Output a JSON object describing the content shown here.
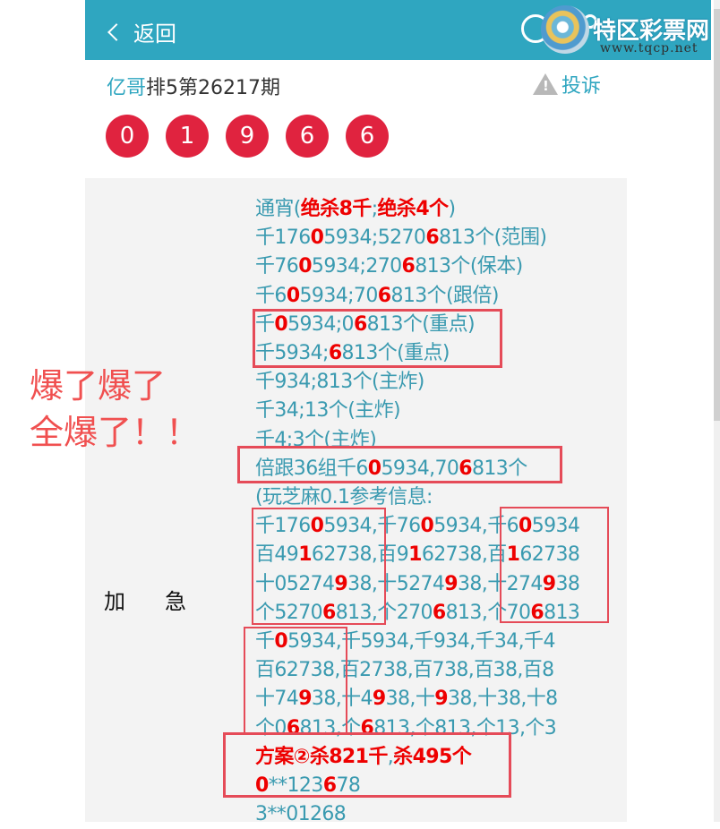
{
  "header": {
    "back_label": "返回",
    "logo_title": "特区彩票网",
    "logo_url": "www.tqcp.net",
    "colors": {
      "bar": "#2fa6c0",
      "ball": "#e0233f",
      "highlight": "#ee0000",
      "annotation": "#f05050"
    }
  },
  "post": {
    "author": "亿哥",
    "title_rest": "排5第26217期",
    "report_label": "投诉",
    "balls": [
      "0",
      "1",
      "9",
      "6",
      "6"
    ],
    "label": "加急"
  },
  "annotation": {
    "line1": "爆了爆了",
    "line2": "全爆了！！"
  },
  "content": {
    "lines": [
      [
        {
          "t": "通宵("
        },
        {
          "t": "绝杀8千",
          "r": true
        },
        {
          "t": ";"
        },
        {
          "t": "绝杀4个",
          "r": true
        },
        {
          "t": ")"
        }
      ],
      [
        {
          "t": "千176"
        },
        {
          "t": "0",
          "r": true
        },
        {
          "t": "5934;5270"
        },
        {
          "t": "6",
          "r": true
        },
        {
          "t": "813个(范围)"
        }
      ],
      [
        {
          "t": "千76"
        },
        {
          "t": "0",
          "r": true
        },
        {
          "t": "5934;270"
        },
        {
          "t": "6",
          "r": true
        },
        {
          "t": "813个(保本)"
        }
      ],
      [
        {
          "t": "千6"
        },
        {
          "t": "0",
          "r": true
        },
        {
          "t": "5934;70"
        },
        {
          "t": "6",
          "r": true
        },
        {
          "t": "813个(跟倍)"
        }
      ],
      [
        {
          "t": "千"
        },
        {
          "t": "0",
          "r": true
        },
        {
          "t": "5934;0"
        },
        {
          "t": "6",
          "r": true
        },
        {
          "t": "813个(重点)"
        }
      ],
      [
        {
          "t": "千5934;"
        },
        {
          "t": "6",
          "r": true
        },
        {
          "t": "813个(重点)"
        }
      ],
      [
        {
          "t": "千934;813个(主炸)"
        }
      ],
      [
        {
          "t": "千34;13个(主炸)"
        }
      ],
      [
        {
          "t": "千4;3个(主炸)"
        }
      ],
      [
        {
          "t": "倍跟36组千6"
        },
        {
          "t": "0",
          "r": true
        },
        {
          "t": "5934,70"
        },
        {
          "t": "6",
          "r": true
        },
        {
          "t": "813个"
        }
      ],
      [
        {
          "t": "(玩芝麻0.1参考信息:"
        }
      ],
      [
        {
          "t": "千176"
        },
        {
          "t": "0",
          "r": true
        },
        {
          "t": "5934,千76"
        },
        {
          "t": "0",
          "r": true
        },
        {
          "t": "5934,千6"
        },
        {
          "t": "0",
          "r": true
        },
        {
          "t": "5934"
        }
      ],
      [
        {
          "t": "百49"
        },
        {
          "t": "1",
          "r": true
        },
        {
          "t": "62738,百9"
        },
        {
          "t": "1",
          "r": true
        },
        {
          "t": "62738,百"
        },
        {
          "t": "1",
          "r": true
        },
        {
          "t": "62738"
        }
      ],
      [
        {
          "t": "十05274"
        },
        {
          "t": "9",
          "r": true
        },
        {
          "t": "38,十5274"
        },
        {
          "t": "9",
          "r": true
        },
        {
          "t": "38,十274"
        },
        {
          "t": "9",
          "r": true
        },
        {
          "t": "38"
        }
      ],
      [
        {
          "t": "个5270"
        },
        {
          "t": "6",
          "r": true
        },
        {
          "t": "813,个270"
        },
        {
          "t": "6",
          "r": true
        },
        {
          "t": "813,个70"
        },
        {
          "t": "6",
          "r": true
        },
        {
          "t": "813"
        }
      ],
      [
        {
          "t": "千"
        },
        {
          "t": "0",
          "r": true
        },
        {
          "t": "5934,千5934,千934,千34,千4"
        }
      ],
      [
        {
          "t": "百62738,百2738,百738,百38,百8"
        }
      ],
      [
        {
          "t": "十74"
        },
        {
          "t": "9",
          "r": true
        },
        {
          "t": "38,十4"
        },
        {
          "t": "9",
          "r": true
        },
        {
          "t": "38,十"
        },
        {
          "t": "9",
          "r": true
        },
        {
          "t": "38,十38,十8"
        }
      ],
      [
        {
          "t": "个0"
        },
        {
          "t": "6",
          "r": true
        },
        {
          "t": "813,个"
        },
        {
          "t": "6",
          "r": true
        },
        {
          "t": "813,个813,个13,个3"
        }
      ],
      [
        {
          "t": "方案②杀821千",
          "r": true
        },
        {
          "t": ","
        },
        {
          "t": "杀495个",
          "r": true
        }
      ],
      [
        {
          "t": "0",
          "r": true
        },
        {
          "t": "**123"
        },
        {
          "t": "6",
          "r": true
        },
        {
          "t": "78"
        }
      ],
      [
        {
          "t": "3**01268"
        }
      ]
    ]
  }
}
